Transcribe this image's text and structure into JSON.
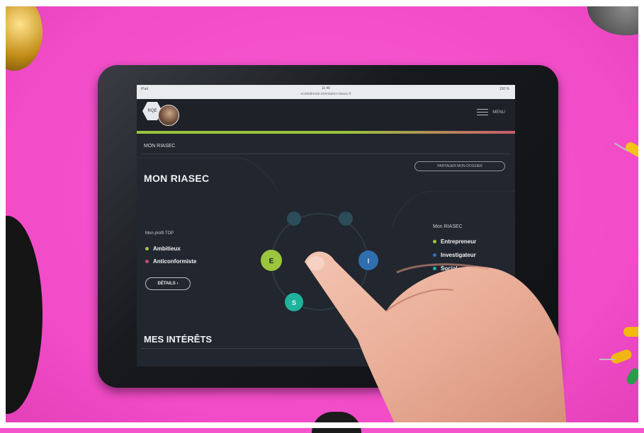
{
  "status_bar": {
    "left": "iPad",
    "time": "11:46",
    "url": "ecoledirecte.orientation-riasec.fr",
    "battery": "100 %"
  },
  "header": {
    "logo_text": "RQE",
    "menu_label": "MENU"
  },
  "breadcrumb": "MON RIASEC",
  "share_button": "PARTAGER MON DOSSIER",
  "page_title": "MON RIASEC",
  "profile": {
    "label": "Mon profil TOP",
    "traits": [
      {
        "label": "Ambitieux",
        "color": "#9bc53d"
      },
      {
        "label": "Anticonformiste",
        "color": "#c94b6a"
      }
    ],
    "details_button": "DÉTAILS"
  },
  "riasec_panel": {
    "label": "Mon RIASEC",
    "items": [
      {
        "label": "Entrepreneur",
        "color": "#9bc53d"
      },
      {
        "label": "Investigateur",
        "color": "#3a6fb5"
      },
      {
        "label": "Social",
        "color": "#21b3a0"
      }
    ]
  },
  "wheel": {
    "nodes": [
      {
        "letter": "E",
        "color": "#9bc53d"
      },
      {
        "letter": "I",
        "color": "#2f6fb0"
      },
      {
        "letter": "S",
        "color": "#1fb39c"
      },
      {
        "letter": "",
        "color": "#2b4d5a"
      },
      {
        "letter": "",
        "color": "#2b4d5a"
      }
    ]
  },
  "section_interests": "MES INTÉRÊTS",
  "colors": {
    "background": "#f653cf",
    "screen": "#22262e",
    "accent_green": "#9bc53d",
    "accent_red": "#c75a6b"
  }
}
